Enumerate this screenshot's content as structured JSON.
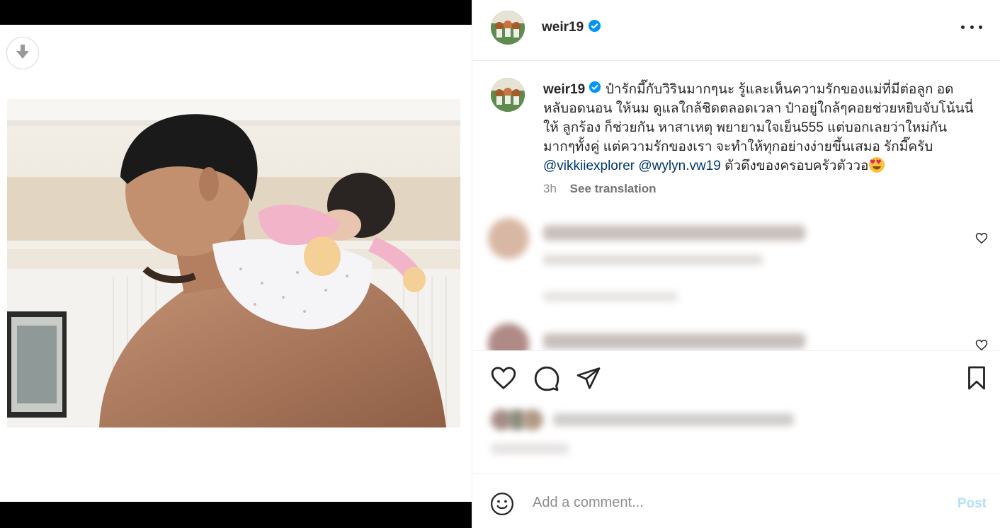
{
  "post": {
    "username": "weir19",
    "caption_text": "ป๋ารักมี๊กับวิรินมากๆนะ รู้และเห็นความรักของแม่ที่มีต่อลูก อดหลับอดนอน ให้นม ดูแลใกล้ชิดตลอดเวลา ป๋าอยู่ใกล้ๆคอยช่วยหยิบจับโน้นนี่ให้ ลูกร้อง ก็ช่วยกัน หาสาเหตุ พยายามใจเย็น555 แต่บอกเลยว่าใหม่กันมากๆทั้งคู่ แต่ความรักของเรา จะทำให้ทุกอย่างง่ายขึ้นเสมอ รักมี๊ครับ",
    "mention_1": "@vikkiiexplorer",
    "mention_2": "@wylyn.vw19",
    "caption_tail": "ตัวตึงของครอบครัวตัววอ",
    "time": "3h",
    "see_translation": "See translation"
  },
  "add_comment": {
    "placeholder": "Add a comment...",
    "post_label": "Post"
  },
  "icons": [
    "download-icon",
    "verified-icon",
    "more-icon",
    "heart-icon",
    "comment-icon",
    "share-icon",
    "bookmark-icon",
    "emoji-icon",
    "heart-small-icon"
  ],
  "colors": {
    "verified": "#0095f6",
    "mention": "#00376b",
    "post_disabled": "#b2dffc",
    "muted": "#8e8e8e"
  }
}
